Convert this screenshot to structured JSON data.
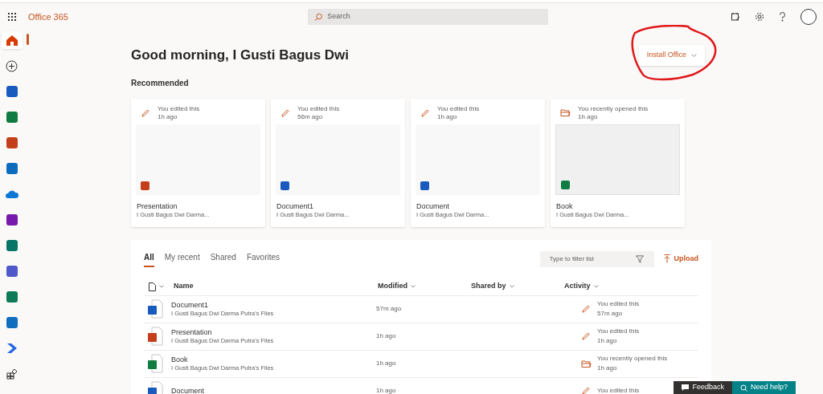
{
  "header": {
    "brand": "Office 365",
    "search_placeholder": "Search"
  },
  "rail": [
    {
      "kind": "home",
      "selected": true
    },
    {
      "kind": "create",
      "selected": false
    },
    {
      "kind": "app",
      "color": "#185abd",
      "selected": false
    },
    {
      "kind": "app",
      "color": "#107c41",
      "selected": false
    },
    {
      "kind": "app",
      "color": "#c43e1c",
      "selected": false
    },
    {
      "kind": "app",
      "color": "#0f6cbd",
      "selected": false
    },
    {
      "kind": "cloud",
      "color": "#0a78d4",
      "selected": false
    },
    {
      "kind": "app",
      "color": "#7719aa",
      "selected": false
    },
    {
      "kind": "app",
      "color": "#077568",
      "selected": false
    },
    {
      "kind": "app",
      "color": "#5059c9",
      "selected": false
    },
    {
      "kind": "app",
      "color": "#0e7a5a",
      "selected": false
    },
    {
      "kind": "app",
      "color": "#106ebe",
      "selected": false
    },
    {
      "kind": "chevron",
      "color": "#2266e3",
      "selected": false
    },
    {
      "kind": "apps",
      "selected": false
    }
  ],
  "greeting": "Good morning, I Gusti Bagus Dwi",
  "install_button": "Install Office",
  "recommended": {
    "title": "Recommended",
    "cards": [
      {
        "activity": {
          "kind": "edit",
          "text": "You edited this",
          "time": "1h ago"
        },
        "thumbnail": {
          "kind": "powerpoint"
        },
        "name": "Presentation",
        "owner": "I Gusti Bagus Dwi Darma..."
      },
      {
        "activity": {
          "kind": "edit",
          "text": "You edited this",
          "time": "56m ago"
        },
        "thumbnail": {
          "kind": "word"
        },
        "name": "Document1",
        "owner": "I Gusti Bagus Dwi Darma..."
      },
      {
        "activity": {
          "kind": "edit",
          "text": "You edited this",
          "time": "1h ago"
        },
        "thumbnail": {
          "kind": "word"
        },
        "name": "Document",
        "owner": "I Gusti Bagus Dwi Darma..."
      },
      {
        "activity": {
          "kind": "open",
          "text": "You recently opened this",
          "time": "1h ago"
        },
        "thumbnail": {
          "kind": "excel"
        },
        "name": "Book",
        "owner": "I Gusti Bagus Dwi Darma..."
      }
    ]
  },
  "files": {
    "tabs": [
      {
        "label": "All",
        "selected": true
      },
      {
        "label": "My recent",
        "selected": false
      },
      {
        "label": "Shared",
        "selected": false
      },
      {
        "label": "Favorites",
        "selected": false
      }
    ],
    "filter_placeholder": "Type to filter list",
    "upload": "Upload",
    "columns": [
      "Name",
      "Modified",
      "Shared by",
      "Activity"
    ],
    "rows": [
      {
        "kind": "word",
        "name": "Document1",
        "location": "I Gusti Bagus Dwi Darma Putra's Files",
        "modified": "57m ago",
        "activity": {
          "kind": "edit",
          "text": "You edited this",
          "time": "57m ago"
        }
      },
      {
        "kind": "powerpoint",
        "name": "Presentation",
        "location": "I Gusti Bagus Dwi Darma Putra's Files",
        "modified": "1h ago",
        "activity": {
          "kind": "edit",
          "text": "You edited this",
          "time": "1h ago"
        }
      },
      {
        "kind": "excel",
        "name": "Book",
        "location": "I Gusti Bagus Dwi Darma Putra's Files",
        "modified": "1h ago",
        "activity": {
          "kind": "open",
          "text": "You recently opened this",
          "time": "1h ago"
        }
      },
      {
        "kind": "word",
        "name": "Document",
        "modified": "1h ago",
        "activity": {
          "kind": "edit",
          "text": "You edited this"
        }
      }
    ]
  },
  "feedback": "Feedback",
  "help": "Need help?"
}
